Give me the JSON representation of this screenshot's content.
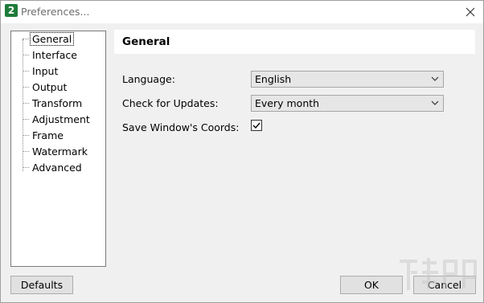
{
  "window": {
    "title": "Preferences...",
    "app_icon_label": "2"
  },
  "tree": {
    "items": [
      {
        "label": "General",
        "selected": true
      },
      {
        "label": "Interface"
      },
      {
        "label": "Input"
      },
      {
        "label": "Output"
      },
      {
        "label": "Transform"
      },
      {
        "label": "Adjustment"
      },
      {
        "label": "Frame"
      },
      {
        "label": "Watermark"
      },
      {
        "label": "Advanced"
      }
    ]
  },
  "panel": {
    "title": "General",
    "fields": {
      "language": {
        "label": "Language:",
        "value": "English"
      },
      "updates": {
        "label": "Check for Updates:",
        "value": "Every month"
      },
      "save_coords": {
        "label": "Save Window's Coords:",
        "checked": true
      }
    }
  },
  "buttons": {
    "defaults": "Defaults",
    "ok": "OK",
    "cancel": "Cancel"
  },
  "icons": {
    "close": "close-icon",
    "chevron": "chevron-down-icon",
    "check": "checkmark-icon"
  }
}
